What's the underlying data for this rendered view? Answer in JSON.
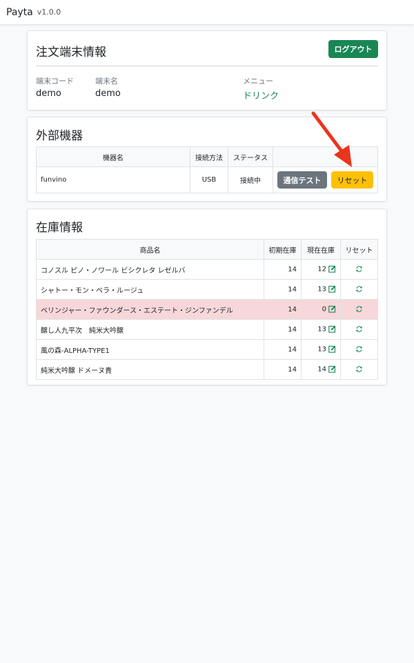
{
  "navbar": {
    "brand": "Payta",
    "version": "v1.0.0"
  },
  "terminal_card": {
    "title": "注文端末情報",
    "logout_label": "ログアウト",
    "code_label": "端末コード",
    "code_value": "demo",
    "name_label": "端末名",
    "name_value": "demo",
    "menu_label": "メニュー",
    "menu_value": "ドリンク"
  },
  "devices_card": {
    "title": "外部機器",
    "headers": [
      "機器名",
      "接続方法",
      "ステータス",
      ""
    ],
    "rows": [
      {
        "name": "funvino",
        "method": "USB",
        "status": "接続中",
        "test_label": "通信テスト",
        "reset_label": "リセット"
      }
    ]
  },
  "stock_card": {
    "title": "在庫情報",
    "headers": [
      "商品名",
      "初期在庫",
      "現在在庫",
      "リセット"
    ],
    "rows": [
      {
        "name": "コノスル ピノ・ノワール ビシクレタ レゼルバ",
        "initial": "14",
        "current": "12",
        "alert": false
      },
      {
        "name": "シャトー・モン・ペラ・ルージュ",
        "initial": "14",
        "current": "13",
        "alert": false
      },
      {
        "name": "ベリンジャー・ファウンダース・エステート・ジンファンデル",
        "initial": "14",
        "current": "0",
        "alert": true
      },
      {
        "name": "醸し人九平次　純米大吟醸",
        "initial": "14",
        "current": "13",
        "alert": false
      },
      {
        "name": "風の森-ALPHA-TYPE1",
        "initial": "14",
        "current": "13",
        "alert": false
      },
      {
        "name": "純米大吟醸 ドメーヌ貴",
        "initial": "14",
        "current": "14",
        "alert": false
      }
    ]
  },
  "colors": {
    "success": "#198754",
    "warning": "#ffc107",
    "secondary": "#6c757d",
    "alert_row": "#f8d7da",
    "annotation_arrow": "#e8361c"
  },
  "icons": {
    "edit": "edit-icon",
    "refresh": "refresh-icon",
    "arrow": "annotation-arrow-icon"
  }
}
